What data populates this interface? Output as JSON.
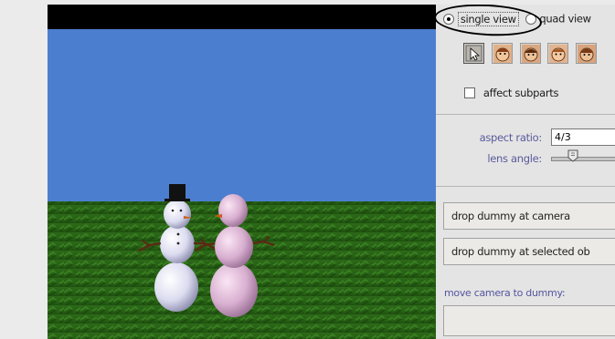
{
  "view_mode": {
    "options": [
      {
        "label": "single view",
        "selected": true
      },
      {
        "label": "quad view",
        "selected": false
      }
    ]
  },
  "tools": [
    {
      "name": "select-arrow",
      "active": true
    },
    {
      "name": "character-face-1"
    },
    {
      "name": "character-face-2"
    },
    {
      "name": "character-face-3"
    },
    {
      "name": "character-face-4"
    }
  ],
  "affect_subparts": {
    "label": "affect subparts",
    "checked": false
  },
  "camera": {
    "aspect_ratio_label": "aspect ratio:",
    "aspect_ratio_value": "4/3",
    "lens_angle_label": "lens angle:"
  },
  "buttons": {
    "drop_at_camera": "drop dummy at camera",
    "drop_at_selected": "drop dummy at selected ob",
    "move_camera_label": "move camera to dummy:"
  },
  "colors": {
    "sky": "#4c7ed0",
    "grass": "#2f6a18",
    "accent_outline": "#000000"
  }
}
